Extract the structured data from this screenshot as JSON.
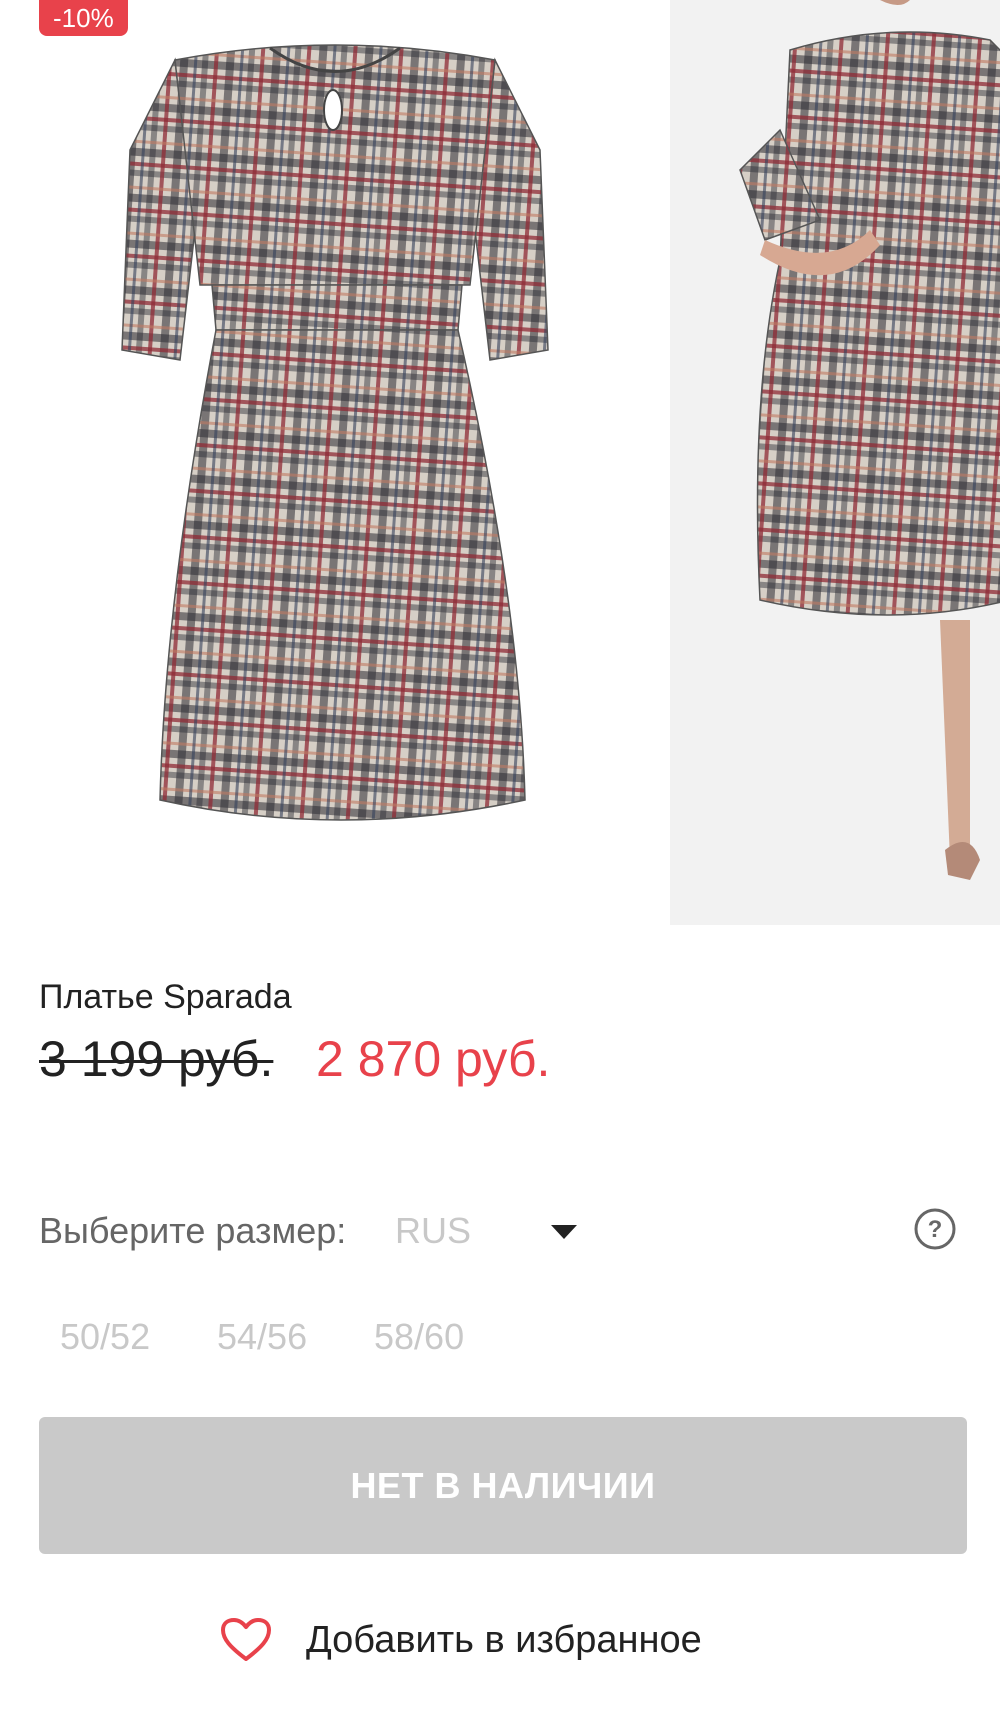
{
  "badge": {
    "discount": "-10%"
  },
  "product": {
    "title": "Платье Sparada",
    "price_old": "3 199 руб.",
    "price_new": "2 870 руб."
  },
  "size_selector": {
    "label": "Выберите размер:",
    "system": "RUS",
    "options": [
      "50/52",
      "54/56",
      "58/60"
    ]
  },
  "cta": {
    "label": "НЕТ В НАЛИЧИИ"
  },
  "favorite": {
    "label": "Добавить в избранное"
  },
  "colors": {
    "accent": "#e8424b",
    "disabled": "#c9c9c9",
    "muted_text": "#c8c8c8"
  },
  "icons": {
    "help": "question-circle-icon",
    "caret": "caret-down-icon",
    "favorite": "heart-outline-icon"
  }
}
